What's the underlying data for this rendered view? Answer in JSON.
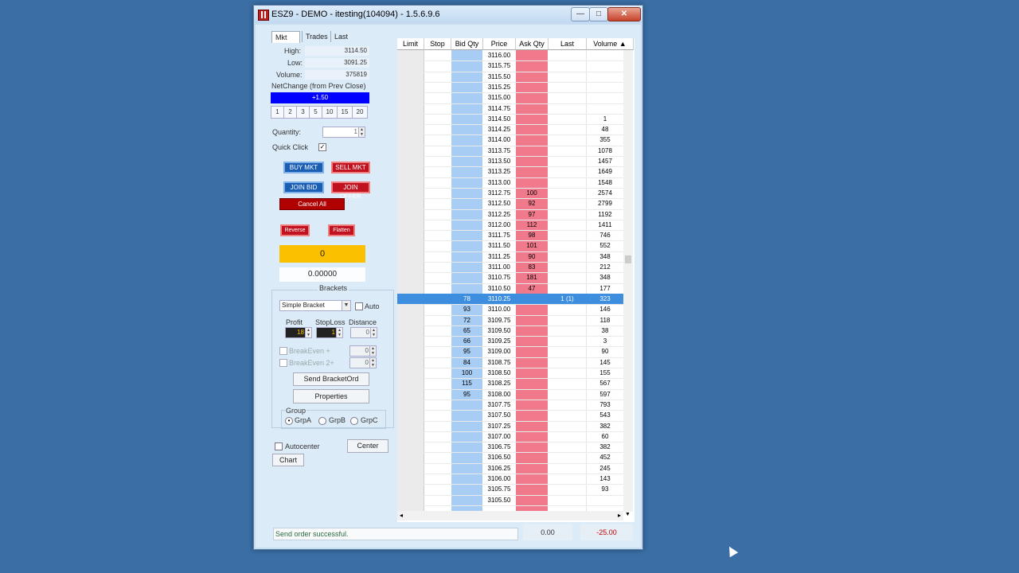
{
  "window": {
    "title": "ESZ9 - DEMO - itesting(104094) - 1.5.6.9.6",
    "min": "—",
    "max": "□",
    "close": "✕"
  },
  "tabs": [
    "Mkt",
    "Trades",
    "Last"
  ],
  "stats": {
    "high_label": "High:",
    "high": "3114.50",
    "low_label": "Low:",
    "low": "3091.25",
    "volume_label": "Volume:",
    "volume": "375819"
  },
  "netchange": {
    "label": "NetChange (from Prev Close)",
    "value": "+1.50"
  },
  "qty_presets": [
    "1",
    "2",
    "3",
    "5",
    "10",
    "15",
    "20"
  ],
  "quantity": {
    "label": "Quantity:",
    "value": "1"
  },
  "quick_click": {
    "label": "Quick Click",
    "checked": "✓"
  },
  "buttons": {
    "buy_mkt": "BUY MKT",
    "sell_mkt": "SELL MKT",
    "join_bid": "JOIN BID",
    "join_offer": "JOIN OFFER",
    "cancel_all": "Cancel All",
    "reverse": "Reverse",
    "flatten": "Flatten"
  },
  "position": "0",
  "pnl_value": "0.00000",
  "brackets": {
    "title": "Brackets",
    "type": "Simple Bracket",
    "auto_label": "Auto",
    "profit_label": "Profit",
    "stoploss_label": "StopLoss",
    "distance_label": "Distance",
    "profit": "18",
    "stoploss": "1",
    "distance": "0",
    "be1_label": "BreakEven +",
    "be1": "0",
    "be2_label": "BreakEven 2+",
    "be2": "0",
    "send": "Send BracketOrd",
    "properties": "Properties"
  },
  "group": {
    "label": "Group",
    "a": "GrpA",
    "b": "GrpB",
    "c": "GrpC",
    "selected": "GrpA"
  },
  "autocenter": "Autocenter",
  "center": "Center",
  "chart": "Chart",
  "columns": [
    "Limit",
    "Stop",
    "Bid Qty",
    "Price",
    "Ask Qty",
    "Last",
    "Volume"
  ],
  "ladder": [
    {
      "price": "3116.00",
      "ask": "",
      "bid": "",
      "last": "",
      "vol": ""
    },
    {
      "price": "3115.75",
      "ask": "",
      "bid": "",
      "last": "",
      "vol": ""
    },
    {
      "price": "3115.50",
      "ask": "",
      "bid": "",
      "last": "",
      "vol": ""
    },
    {
      "price": "3115.25",
      "ask": "",
      "bid": "",
      "last": "",
      "vol": ""
    },
    {
      "price": "3115.00",
      "ask": "",
      "bid": "",
      "last": "",
      "vol": ""
    },
    {
      "price": "3114.75",
      "ask": "",
      "bid": "",
      "last": "",
      "vol": ""
    },
    {
      "price": "3114.50",
      "ask": "",
      "bid": "",
      "last": "",
      "vol": "1"
    },
    {
      "price": "3114.25",
      "ask": "",
      "bid": "",
      "last": "",
      "vol": "48"
    },
    {
      "price": "3114.00",
      "ask": "",
      "bid": "",
      "last": "",
      "vol": "355"
    },
    {
      "price": "3113.75",
      "ask": "",
      "bid": "",
      "last": "",
      "vol": "1078"
    },
    {
      "price": "3113.50",
      "ask": "",
      "bid": "",
      "last": "",
      "vol": "1457"
    },
    {
      "price": "3113.25",
      "ask": "",
      "bid": "",
      "last": "",
      "vol": "1649"
    },
    {
      "price": "3113.00",
      "ask": "",
      "bid": "",
      "last": "",
      "vol": "1548"
    },
    {
      "price": "3112.75",
      "ask": "100",
      "bid": "",
      "last": "",
      "vol": "2574"
    },
    {
      "price": "3112.50",
      "ask": "92",
      "bid": "",
      "last": "",
      "vol": "2799"
    },
    {
      "price": "3112.25",
      "ask": "97",
      "bid": "",
      "last": "",
      "vol": "1192"
    },
    {
      "price": "3112.00",
      "ask": "112",
      "bid": "",
      "last": "",
      "vol": "1411"
    },
    {
      "price": "3111.75",
      "ask": "98",
      "bid": "",
      "last": "",
      "vol": "746"
    },
    {
      "price": "3111.50",
      "ask": "101",
      "bid": "",
      "last": "",
      "vol": "552"
    },
    {
      "price": "3111.25",
      "ask": "90",
      "bid": "",
      "last": "",
      "vol": "348"
    },
    {
      "price": "3111.00",
      "ask": "83",
      "bid": "",
      "last": "",
      "vol": "212"
    },
    {
      "price": "3110.75",
      "ask": "181",
      "bid": "",
      "last": "",
      "vol": "348"
    },
    {
      "price": "3110.50",
      "ask": "47",
      "bid": "",
      "last": "",
      "vol": "177"
    },
    {
      "price": "3110.25",
      "ask": "",
      "bid": "78",
      "last": "1 (1)",
      "vol": "323",
      "selected": true
    },
    {
      "price": "3110.00",
      "ask": "",
      "bid": "93",
      "last": "",
      "vol": "146"
    },
    {
      "price": "3109.75",
      "ask": "",
      "bid": "72",
      "last": "",
      "vol": "118"
    },
    {
      "price": "3109.50",
      "ask": "",
      "bid": "65",
      "last": "",
      "vol": "38"
    },
    {
      "price": "3109.25",
      "ask": "",
      "bid": "66",
      "last": "",
      "vol": "3"
    },
    {
      "price": "3109.00",
      "ask": "",
      "bid": "95",
      "last": "",
      "vol": "90"
    },
    {
      "price": "3108.75",
      "ask": "",
      "bid": "84",
      "last": "",
      "vol": "145"
    },
    {
      "price": "3108.50",
      "ask": "",
      "bid": "100",
      "last": "",
      "vol": "155"
    },
    {
      "price": "3108.25",
      "ask": "",
      "bid": "115",
      "last": "",
      "vol": "567"
    },
    {
      "price": "3108.00",
      "ask": "",
      "bid": "95",
      "last": "",
      "vol": "597"
    },
    {
      "price": "3107.75",
      "ask": "",
      "bid": "",
      "last": "",
      "vol": "793"
    },
    {
      "price": "3107.50",
      "ask": "",
      "bid": "",
      "last": "",
      "vol": "543"
    },
    {
      "price": "3107.25",
      "ask": "",
      "bid": "",
      "last": "",
      "vol": "382"
    },
    {
      "price": "3107.00",
      "ask": "",
      "bid": "",
      "last": "",
      "vol": "60"
    },
    {
      "price": "3106.75",
      "ask": "",
      "bid": "",
      "last": "",
      "vol": "382"
    },
    {
      "price": "3106.50",
      "ask": "",
      "bid": "",
      "last": "",
      "vol": "452"
    },
    {
      "price": "3106.25",
      "ask": "",
      "bid": "",
      "last": "",
      "vol": "245"
    },
    {
      "price": "3106.00",
      "ask": "",
      "bid": "",
      "last": "",
      "vol": "143"
    },
    {
      "price": "3105.75",
      "ask": "",
      "bid": "",
      "last": "",
      "vol": "93"
    },
    {
      "price": "3105.50",
      "ask": "",
      "bid": "",
      "last": "",
      "vol": ""
    }
  ],
  "status": {
    "message": "Send order successful.",
    "left_value": "0.00",
    "right_value": "-25.00"
  },
  "colors": {
    "bid": "#a8cdf5",
    "ask": "#f07a8c",
    "limit": "#ebebeb",
    "selected": "#3d8ede",
    "net": "#0000ff"
  }
}
